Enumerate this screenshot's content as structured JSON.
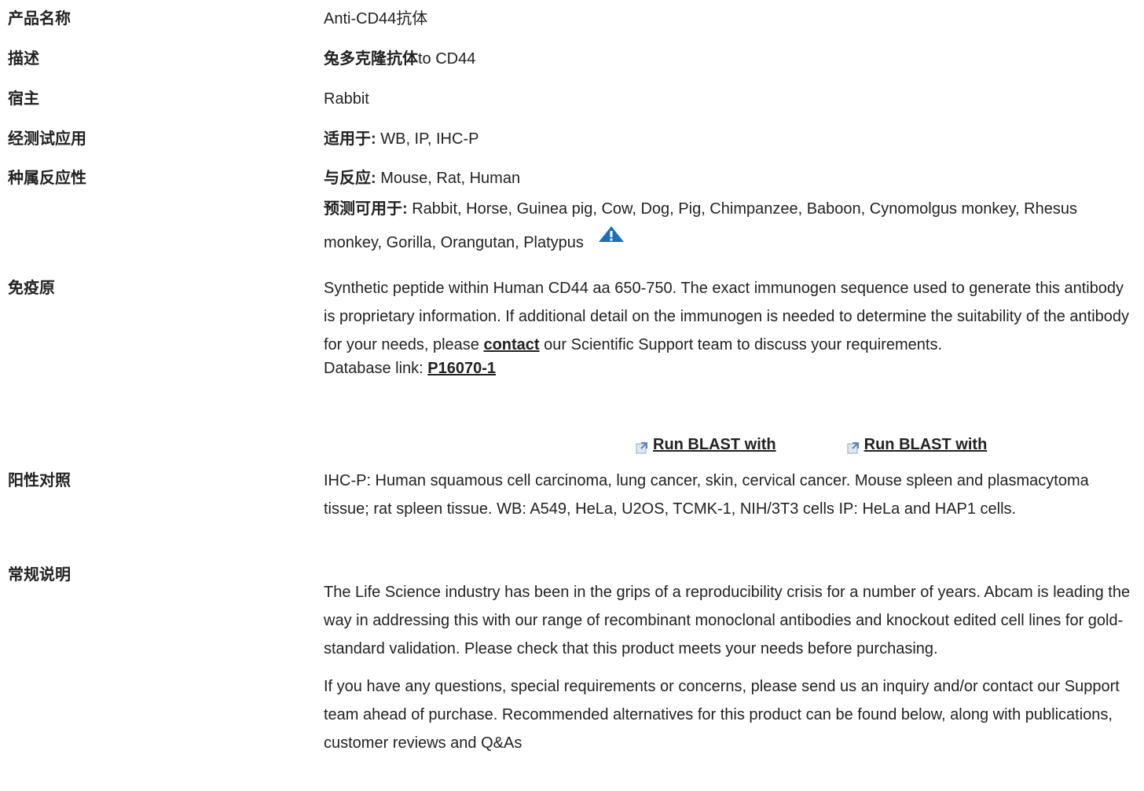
{
  "rows": {
    "product_name": {
      "label": "产品名称",
      "value": "Anti-CD44抗体"
    },
    "description": {
      "label": "描述",
      "value_bold": "兔多克隆抗体",
      "value_rest": "to CD44"
    },
    "host": {
      "label": "宿主",
      "value": "Rabbit"
    },
    "applications": {
      "label": "经测试应用",
      "prefix": "适用于:",
      "value": " WB, IP, IHC-P"
    },
    "species": {
      "label": "种属反应性",
      "reacts_prefix": "与反应:",
      "reacts_value": " Mouse, Rat, Human",
      "predicted_prefix": "预测可用于:",
      "predicted_value": " Rabbit, Horse, Guinea pig, Cow, Dog, Pig, Chimpanzee, Baboon, Cynomolgus monkey, Rhesus monkey, Gorilla, Orangutan, Platypus"
    },
    "immunogen": {
      "label": "免疫原",
      "text_before": "Synthetic peptide within Human CD44 aa 650-750. The exact immunogen sequence used to generate this antibody is proprietary information. If additional detail on the immunogen is needed to determine the suitability of the antibody for your needs, please ",
      "contact_link": "contact",
      "text_after": " our Scientific Support team to discuss your requirements.",
      "db_prefix": "Database link: ",
      "db_link": "P16070-1",
      "blast_1": "Run BLAST with",
      "blast_2": "Run BLAST with"
    },
    "positive_control": {
      "label": "阳性对照",
      "value": "IHC-P: Human squamous cell carcinoma, lung cancer, skin, cervical cancer. Mouse spleen and plasmacytoma tissue; rat spleen tissue. WB: A549, HeLa, U2OS, TCMK-1, NIH/3T3 cells IP: HeLa and HAP1 cells."
    },
    "general_notes": {
      "label": "常规说明",
      "para1": "The Life Science industry has been in the grips of a reproducibility crisis for a number of years. Abcam is leading the way in addressing this with our range of recombinant monoclonal antibodies and knockout edited cell lines for gold-standard validation. Please check that this product meets your needs before purchasing.",
      "para2": "If you have any questions, special requirements or concerns, please send us an inquiry and/or contact our Support team ahead of purchase. Recommended alternatives for this product can be found below, along with publications, customer reviews and Q&As"
    }
  },
  "icons": {
    "warning": "warning-triangle-icon",
    "blast": "external-link-icon"
  },
  "colors": {
    "warning_icon": "#1e6fb8",
    "text": "#222222"
  }
}
